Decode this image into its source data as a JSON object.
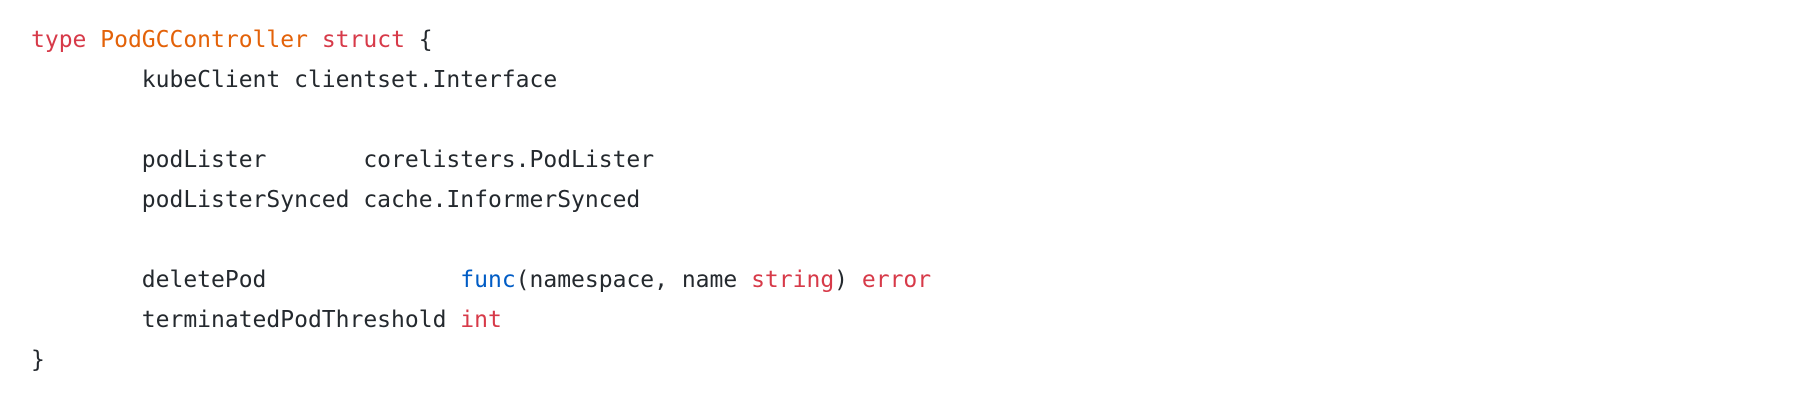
{
  "code": {
    "lines": [
      {
        "tokens": [
          {
            "text": "type",
            "class": "tok-kw"
          },
          {
            "text": " ",
            "class": "tok-plain"
          },
          {
            "text": "PodGCController",
            "class": "tok-type"
          },
          {
            "text": " ",
            "class": "tok-plain"
          },
          {
            "text": "struct",
            "class": "tok-kw"
          },
          {
            "text": " {",
            "class": "tok-plain"
          }
        ]
      },
      {
        "tokens": [
          {
            "text": "\tkubeClient clientset.Interface",
            "class": "tok-plain"
          }
        ]
      },
      {
        "tokens": []
      },
      {
        "tokens": [
          {
            "text": "\tpodLister       corelisters.PodLister",
            "class": "tok-plain"
          }
        ]
      },
      {
        "tokens": [
          {
            "text": "\tpodListerSynced cache.InformerSynced",
            "class": "tok-plain"
          }
        ]
      },
      {
        "tokens": []
      },
      {
        "tokens": [
          {
            "text": "\tdeletePod              ",
            "class": "tok-plain"
          },
          {
            "text": "func",
            "class": "tok-blue"
          },
          {
            "text": "(namespace, name ",
            "class": "tok-plain"
          },
          {
            "text": "string",
            "class": "tok-kw"
          },
          {
            "text": ") ",
            "class": "tok-plain"
          },
          {
            "text": "error",
            "class": "tok-kw"
          }
        ]
      },
      {
        "tokens": [
          {
            "text": "\tterminatedPodThreshold ",
            "class": "tok-plain"
          },
          {
            "text": "int",
            "class": "tok-kw"
          }
        ]
      },
      {
        "tokens": [
          {
            "text": "}",
            "class": "tok-plain"
          }
        ]
      }
    ]
  }
}
